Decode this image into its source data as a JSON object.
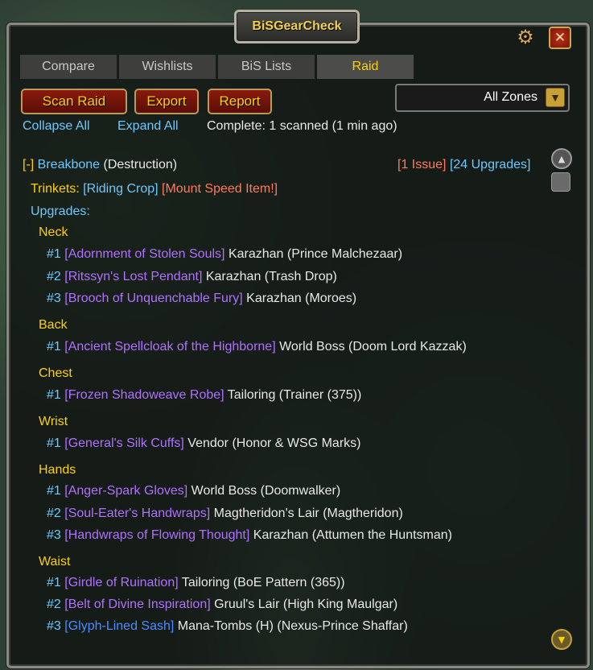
{
  "window": {
    "title": "BiSGearCheck",
    "settings_icon": "gear-icon",
    "close_label": "✕"
  },
  "tabs": [
    {
      "label": "Compare"
    },
    {
      "label": "Wishlists"
    },
    {
      "label": "BiS Lists"
    },
    {
      "label": "Raid",
      "active": true
    }
  ],
  "actions": {
    "scan": "Scan Raid",
    "export": "Export",
    "report": "Report"
  },
  "zone_select": {
    "value": "All Zones"
  },
  "links": {
    "collapse": "Collapse All",
    "expand": "Expand All",
    "status": "Complete: 1 scanned (1 min ago)"
  },
  "player": {
    "toggle": "[-]",
    "name": "Breakbone",
    "spec": "(Destruction)",
    "issues": "[1 Issue]",
    "upgrades": "[24 Upgrades]"
  },
  "trinkets": {
    "label": "Trinkets:",
    "item1": "[Riding Crop]",
    "item2": "[Mount Speed Item!]"
  },
  "upgrades_label": "Upgrades:",
  "slots": [
    {
      "name": "Neck",
      "items": [
        {
          "rank": "#1",
          "item": "[Adornment of Stolen Souls]",
          "source": "Karazhan (Prince Malchezaar)",
          "quality": "purple"
        },
        {
          "rank": "#2",
          "item": "[Ritssyn's Lost Pendant]",
          "source": "Karazhan (Trash Drop)",
          "quality": "purple"
        },
        {
          "rank": "#3",
          "item": "[Brooch of Unquenchable Fury]",
          "source": "Karazhan (Moroes)",
          "quality": "purple"
        }
      ]
    },
    {
      "name": "Back",
      "items": [
        {
          "rank": "#1",
          "item": "[Ancient Spellcloak of the Highborne]",
          "source": "World Boss (Doom Lord Kazzak)",
          "quality": "purple"
        }
      ]
    },
    {
      "name": "Chest",
      "items": [
        {
          "rank": "#1",
          "item": "[Frozen Shadoweave Robe]",
          "source": "Tailoring (Trainer (375))",
          "quality": "purple"
        }
      ]
    },
    {
      "name": "Wrist",
      "items": [
        {
          "rank": "#1",
          "item": "[General's Silk Cuffs]",
          "source": "Vendor (Honor & WSG Marks)",
          "quality": "purple"
        }
      ]
    },
    {
      "name": "Hands",
      "items": [
        {
          "rank": "#1",
          "item": "[Anger-Spark Gloves]",
          "source": "World Boss (Doomwalker)",
          "quality": "purple"
        },
        {
          "rank": "#2",
          "item": "[Soul-Eater's Handwraps]",
          "source": "Magtheridon's Lair (Magtheridon)",
          "quality": "purple"
        },
        {
          "rank": "#3",
          "item": "[Handwraps of Flowing Thought]",
          "source": "Karazhan (Attumen the Huntsman)",
          "quality": "purple"
        }
      ]
    },
    {
      "name": "Waist",
      "items": [
        {
          "rank": "#1",
          "item": "[Girdle of Ruination]",
          "source": "Tailoring (BoE Pattern (365))",
          "quality": "purple"
        },
        {
          "rank": "#2",
          "item": "[Belt of Divine Inspiration]",
          "source": "Gruul's Lair (High King Maulgar)",
          "quality": "purple"
        },
        {
          "rank": "#3",
          "item": "[Glyph-Lined Sash]",
          "source": "Mana-Tombs (H) (Nexus-Prince Shaffar)",
          "quality": "blue"
        }
      ]
    }
  ],
  "colors": {
    "gold": "#ffd100",
    "cyan": "#6cc8ff",
    "epic": "#b070ff",
    "rare": "#4a8cff",
    "issue": "#ff7a5a"
  }
}
